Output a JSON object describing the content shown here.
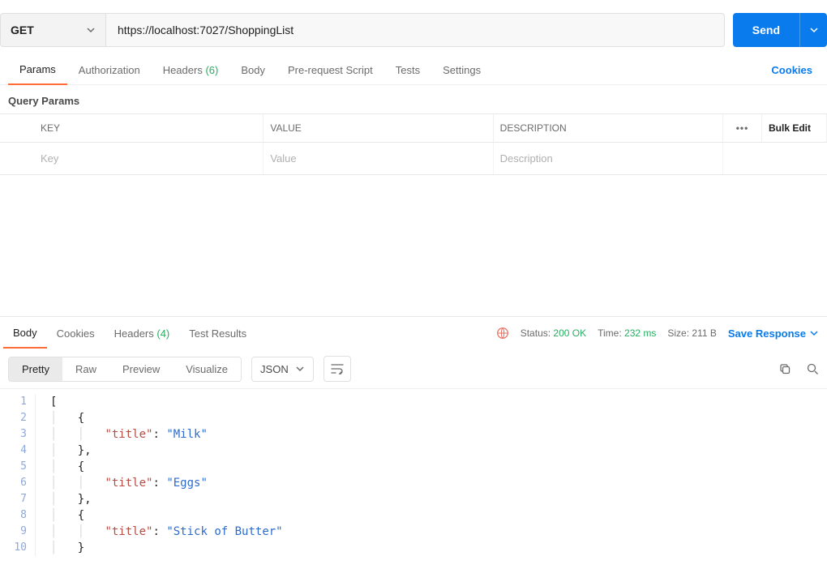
{
  "request": {
    "method": "GET",
    "url": "https://localhost:7027/ShoppingList",
    "send_label": "Send"
  },
  "req_tabs": {
    "params": "Params",
    "authorization": "Authorization",
    "headers": "Headers",
    "headers_count": "(6)",
    "body": "Body",
    "prerequest": "Pre-request Script",
    "tests": "Tests",
    "settings": "Settings",
    "cookies_link": "Cookies"
  },
  "query_params": {
    "section_label": "Query Params",
    "col_key": "KEY",
    "col_value": "VALUE",
    "col_desc": "DESCRIPTION",
    "bulk_edit": "Bulk Edit",
    "ph_key": "Key",
    "ph_value": "Value",
    "ph_desc": "Description"
  },
  "resp_tabs": {
    "body": "Body",
    "cookies": "Cookies",
    "headers": "Headers",
    "headers_count": "(4)",
    "test_results": "Test Results"
  },
  "status": {
    "status_label": "Status:",
    "status_value": "200 OK",
    "time_label": "Time:",
    "time_value": "232 ms",
    "size_label": "Size:",
    "size_value": "211 B",
    "save_response": "Save Response"
  },
  "view": {
    "pretty": "Pretty",
    "raw": "Raw",
    "preview": "Preview",
    "visualize": "Visualize",
    "format": "JSON"
  },
  "response_body": [
    {
      "title": "Milk"
    },
    {
      "title": "Eggs"
    },
    {
      "title": "Stick of Butter"
    }
  ],
  "code_lines": [
    {
      "n": 1,
      "indent": 0,
      "tokens": [
        {
          "t": "punc",
          "v": "["
        }
      ]
    },
    {
      "n": 2,
      "indent": 1,
      "tokens": [
        {
          "t": "punc",
          "v": "{"
        }
      ]
    },
    {
      "n": 3,
      "indent": 2,
      "tokens": [
        {
          "t": "key",
          "v": "\"title\""
        },
        {
          "t": "punc",
          "v": ": "
        },
        {
          "t": "str",
          "v": "\"Milk\""
        }
      ]
    },
    {
      "n": 4,
      "indent": 1,
      "tokens": [
        {
          "t": "punc",
          "v": "},"
        }
      ]
    },
    {
      "n": 5,
      "indent": 1,
      "tokens": [
        {
          "t": "punc",
          "v": "{"
        }
      ]
    },
    {
      "n": 6,
      "indent": 2,
      "tokens": [
        {
          "t": "key",
          "v": "\"title\""
        },
        {
          "t": "punc",
          "v": ": "
        },
        {
          "t": "str",
          "v": "\"Eggs\""
        }
      ]
    },
    {
      "n": 7,
      "indent": 1,
      "tokens": [
        {
          "t": "punc",
          "v": "},"
        }
      ]
    },
    {
      "n": 8,
      "indent": 1,
      "tokens": [
        {
          "t": "punc",
          "v": "{"
        }
      ]
    },
    {
      "n": 9,
      "indent": 2,
      "tokens": [
        {
          "t": "key",
          "v": "\"title\""
        },
        {
          "t": "punc",
          "v": ": "
        },
        {
          "t": "str",
          "v": "\"Stick of Butter\""
        }
      ]
    },
    {
      "n": 10,
      "indent": 1,
      "tokens": [
        {
          "t": "punc",
          "v": "}"
        }
      ]
    }
  ]
}
